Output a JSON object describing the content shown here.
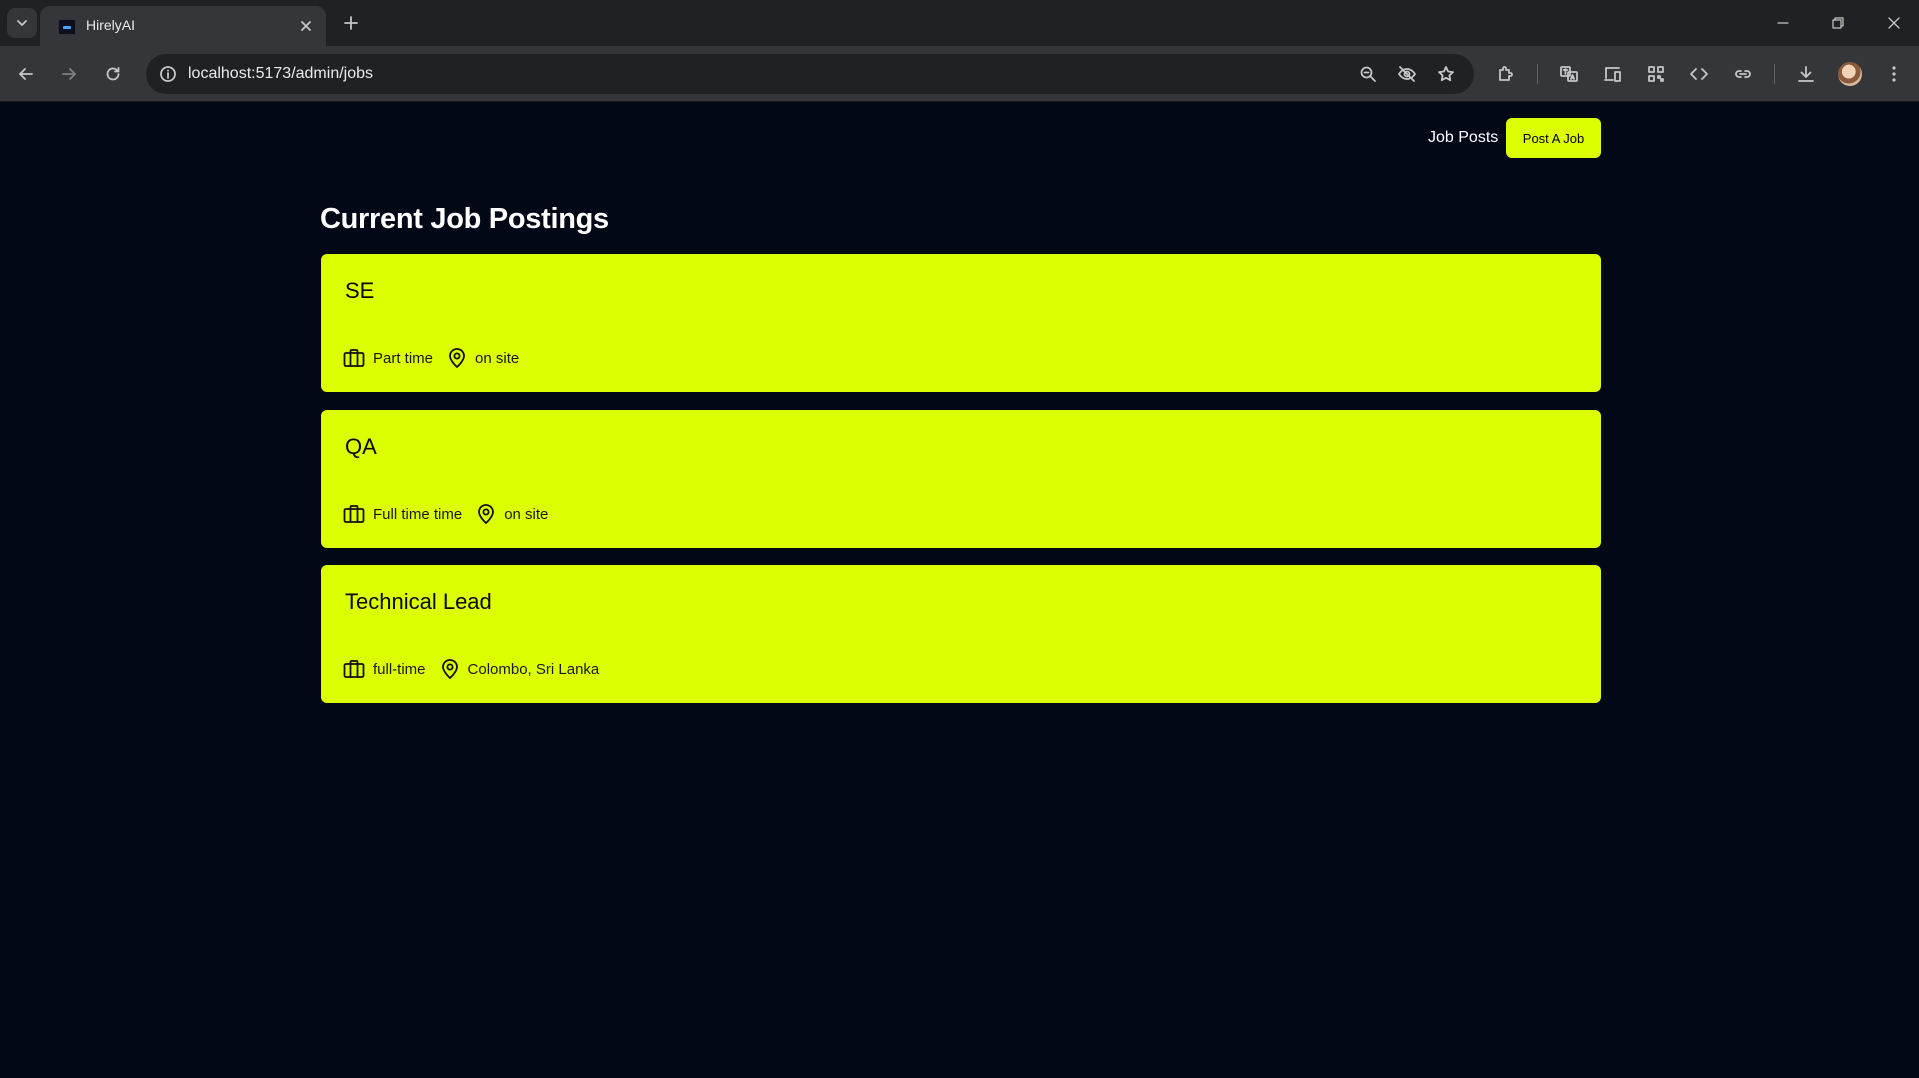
{
  "browser": {
    "tab_title": "HirelyAI",
    "url": "localhost:5173/admin/jobs"
  },
  "nav": {
    "job_posts_label": "Job Posts",
    "post_job_label": "Post A Job"
  },
  "page": {
    "heading": "Current Job Postings"
  },
  "jobs": [
    {
      "title": "SE",
      "type": "Part time",
      "location": "on site"
    },
    {
      "title": "QA",
      "type": "Full time time",
      "location": "on site"
    },
    {
      "title": "Technical Lead",
      "type": "full-time",
      "location": "Colombo, Sri Lanka"
    }
  ],
  "colors": {
    "accent": "#dcff02",
    "background": "#030817"
  }
}
